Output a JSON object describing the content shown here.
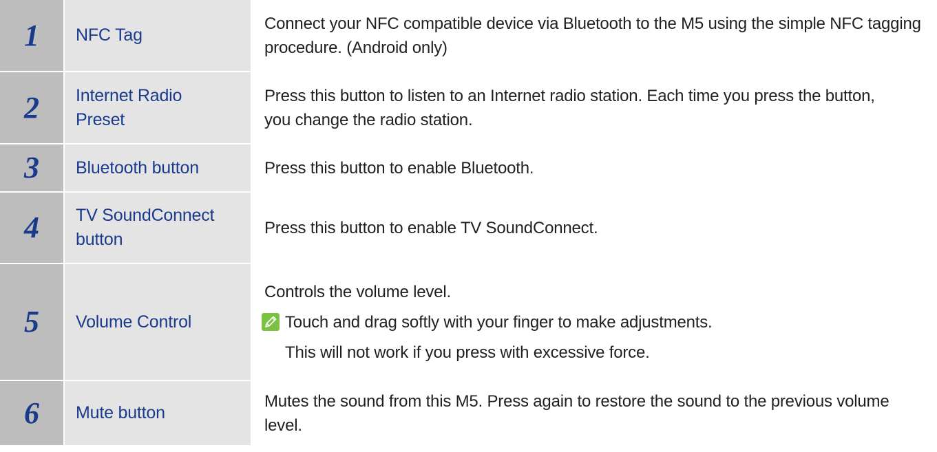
{
  "rows": [
    {
      "number": "1",
      "label": "NFC Tag",
      "description": "Connect your NFC compatible device via Bluetooth to the M5 using the simple NFC tagging procedure. (Android only)"
    },
    {
      "number": "2",
      "label": "Internet Radio Preset",
      "description": "Press this button to listen to an Internet radio station. Each time you press the button, you change the radio station."
    },
    {
      "number": "3",
      "label": "Bluetooth button",
      "description": "Press this button to enable Bluetooth."
    },
    {
      "number": "4",
      "label": "TV SoundConnect button",
      "description": "Press this button to enable TV SoundConnect."
    },
    {
      "number": "5",
      "label": "Volume Control",
      "description": "Controls the volume level.",
      "note_icon": "note-pencil-icon",
      "note_line1": "Touch and drag softly with your finger to make adjustments.",
      "note_line2": "This will not work if you press with excessive force."
    },
    {
      "number": "6",
      "label": "Mute button",
      "description": "Mutes the sound from this M5. Press again to restore the sound to the previous volume level."
    }
  ],
  "colors": {
    "number_cell": "#bdbdbd",
    "label_cell": "#e4e4e4",
    "accent_text": "#1a3a8c",
    "note_icon": "#7cc242"
  }
}
